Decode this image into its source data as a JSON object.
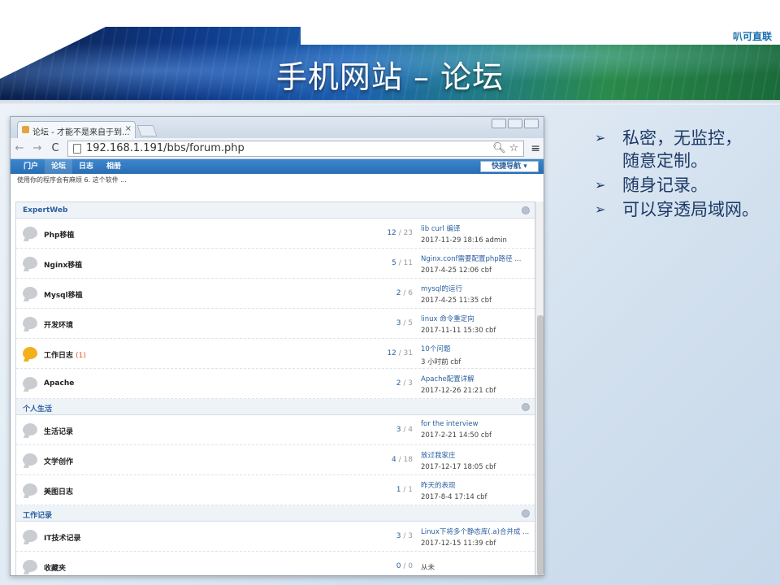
{
  "slide": {
    "brand": "叭可直联",
    "title": "手机网站 – 论坛"
  },
  "browser": {
    "tab_title": "论坛 - 才能不是来自于到...",
    "tab_close": "×",
    "url": "192.168.1.191/bbs/forum.php"
  },
  "site": {
    "nav_items": [
      "门户",
      "论坛",
      "日志",
      "相册"
    ],
    "quick_nav": "快捷导航",
    "notice": "使用你的程序会有麻烦 6. 这个软件 ..."
  },
  "categories": [
    {
      "name": "ExpertWeb",
      "forums": [
        {
          "name": "Php移植",
          "today": "",
          "threads": "12",
          "posts": "23",
          "last_title": "lib curl 编译",
          "last_meta": "2017-11-29 18:16 admin"
        },
        {
          "name": "Nginx移植",
          "today": "",
          "threads": "5",
          "posts": "11",
          "last_title": "Nginx.conf需要配置php路径 ...",
          "last_meta": "2017-4-25 12:06 cbf"
        },
        {
          "name": "Mysql移植",
          "today": "",
          "threads": "2",
          "posts": "6",
          "last_title": "mysql的运行",
          "last_meta": "2017-4-25 11:35 cbf"
        },
        {
          "name": "开发环境",
          "today": "",
          "threads": "3",
          "posts": "5",
          "last_title": "linux 命令重定向",
          "last_meta": "2017-11-11 15:30 cbf"
        },
        {
          "name": "工作日志",
          "today": "(1)",
          "threads": "12",
          "posts": "31",
          "last_title": "10个问题",
          "last_meta": "3 小时前 cbf",
          "new": true
        },
        {
          "name": "Apache",
          "today": "",
          "threads": "2",
          "posts": "3",
          "last_title": "Apache配置详解",
          "last_meta": "2017-12-26 21:21 cbf"
        }
      ]
    },
    {
      "name": "个人生活",
      "forums": [
        {
          "name": "生活记录",
          "today": "",
          "threads": "3",
          "posts": "4",
          "last_title": "for the interview",
          "last_meta": "2017-2-21 14:50 cbf"
        },
        {
          "name": "文学创作",
          "today": "",
          "threads": "4",
          "posts": "18",
          "last_title": "放过我家庄",
          "last_meta": "2017-12-17 18:05 cbf"
        },
        {
          "name": "美图日志",
          "today": "",
          "threads": "1",
          "posts": "1",
          "last_title": "昨天的表现",
          "last_meta": "2017-8-4 17:14 cbf"
        }
      ]
    },
    {
      "name": "工作记录",
      "forums": [
        {
          "name": "IT技术记录",
          "today": "",
          "threads": "3",
          "posts": "3",
          "last_title": "Linux下将多个静态库(.a)合并成 ...",
          "last_meta": "2017-12-15 11:39 cbf"
        },
        {
          "name": "收藏夹",
          "today": "",
          "threads": "0",
          "posts": "0",
          "last_title": "",
          "last_meta": "从未"
        }
      ]
    }
  ],
  "bullets": [
    {
      "icon": "➢",
      "lines": [
        "私密，无监控，",
        "随意定制。"
      ]
    },
    {
      "icon": "➢",
      "lines": [
        "随身记录。"
      ]
    },
    {
      "icon": "➢",
      "lines": [
        "可以穿透局域网。"
      ]
    }
  ]
}
